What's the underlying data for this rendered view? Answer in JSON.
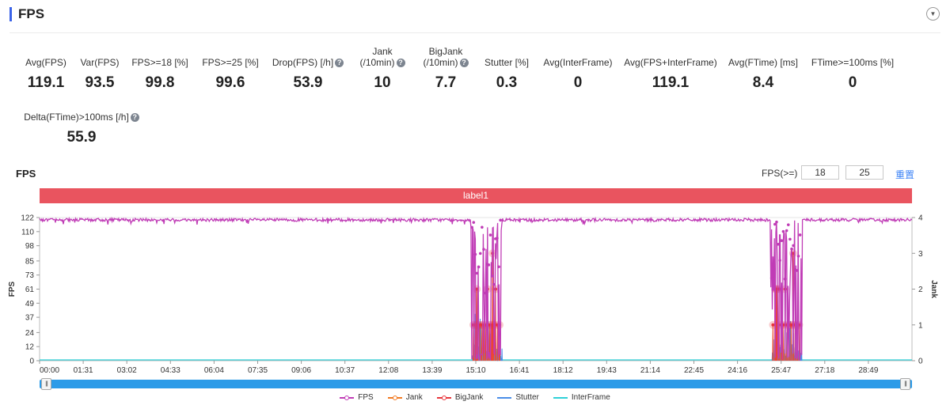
{
  "header": {
    "title": "FPS"
  },
  "metrics_row1": [
    {
      "label": [
        "Avg(FPS)"
      ],
      "value": "119.1",
      "help": false
    },
    {
      "label": [
        "Var(FPS)"
      ],
      "value": "93.5",
      "help": false
    },
    {
      "label": [
        "FPS>=18 [%]"
      ],
      "value": "99.8",
      "help": false
    },
    {
      "label": [
        "FPS>=25 [%]"
      ],
      "value": "99.6",
      "help": false
    },
    {
      "label": [
        "Drop(FPS) [/h]"
      ],
      "value": "53.9",
      "help": true
    },
    {
      "label": [
        "Jank",
        "(/10min)"
      ],
      "value": "10",
      "help": true
    },
    {
      "label": [
        "BigJank",
        "(/10min)"
      ],
      "value": "7.7",
      "help": true
    },
    {
      "label": [
        "Stutter [%]"
      ],
      "value": "0.3",
      "help": false
    },
    {
      "label": [
        "Avg(InterFrame)"
      ],
      "value": "0",
      "help": false
    },
    {
      "label": [
        "Avg(FPS+InterFrame)"
      ],
      "value": "119.1",
      "help": false
    },
    {
      "label": [
        "Avg(FTime) [ms]"
      ],
      "value": "8.4",
      "help": false
    },
    {
      "label": [
        "FTime>=100ms [%]"
      ],
      "value": "0",
      "help": false
    }
  ],
  "metrics_row2": [
    {
      "label": [
        "Delta(FTime)>100ms [/h]"
      ],
      "value": "55.9",
      "help": true
    }
  ],
  "help_glyph": "?",
  "chart_section": {
    "title": "FPS",
    "threshold_label": "FPS(>=)",
    "threshold_low": "18",
    "threshold_high": "25",
    "reset_label": "重置",
    "band_label": "label1"
  },
  "colors": {
    "fps": "#c03cb6",
    "jank": "#f27a22",
    "bigjank": "#e8353b",
    "stutter": "#4a8de8",
    "interframe": "#2ed0d8",
    "band": "#e9545f",
    "slider": "#2c9be8"
  },
  "chart_data": {
    "type": "line",
    "y_axis_left": {
      "label": "FPS",
      "ticks": [
        0,
        12,
        24,
        37,
        49,
        61,
        73,
        85,
        98,
        110,
        122
      ],
      "range": [
        0,
        122
      ]
    },
    "y_axis_right": {
      "label": "Jank",
      "ticks": [
        0,
        1,
        2,
        3,
        4
      ],
      "range": [
        0,
        4
      ]
    },
    "x_axis": {
      "range_sec": [
        0,
        1820
      ],
      "tick_labels": [
        "00:00",
        "01:31",
        "03:02",
        "04:33",
        "06:04",
        "07:35",
        "09:06",
        "10:37",
        "12:08",
        "13:39",
        "15:10",
        "16:41",
        "18:12",
        "19:43",
        "21:14",
        "22:45",
        "24:16",
        "25:47",
        "27:18",
        "28:49"
      ],
      "tick_values_sec": [
        0,
        91,
        182,
        273,
        364,
        455,
        546,
        637,
        728,
        819,
        910,
        1001,
        1092,
        1183,
        1274,
        1365,
        1456,
        1547,
        1638,
        1729
      ]
    },
    "legend": [
      "FPS",
      "Jank",
      "BigJank",
      "Stutter",
      "InterFrame"
    ],
    "series_summary": [
      {
        "name": "FPS",
        "baseline": 120,
        "drop_segments_sec": [
          [
            900,
            965
          ],
          [
            1525,
            1590
          ]
        ]
      },
      {
        "name": "Jank",
        "spike_segments_sec": [
          [
            905,
            960
          ],
          [
            1530,
            1585
          ]
        ],
        "typical_value": 1
      },
      {
        "name": "BigJank",
        "spike_segments_sec": [
          [
            905,
            960
          ],
          [
            1530,
            1585
          ]
        ],
        "max_value": 3
      },
      {
        "name": "Stutter",
        "spike_segments_sec": [
          [
            905,
            965
          ],
          [
            1530,
            1590
          ]
        ]
      },
      {
        "name": "InterFrame",
        "value": 0
      }
    ]
  }
}
